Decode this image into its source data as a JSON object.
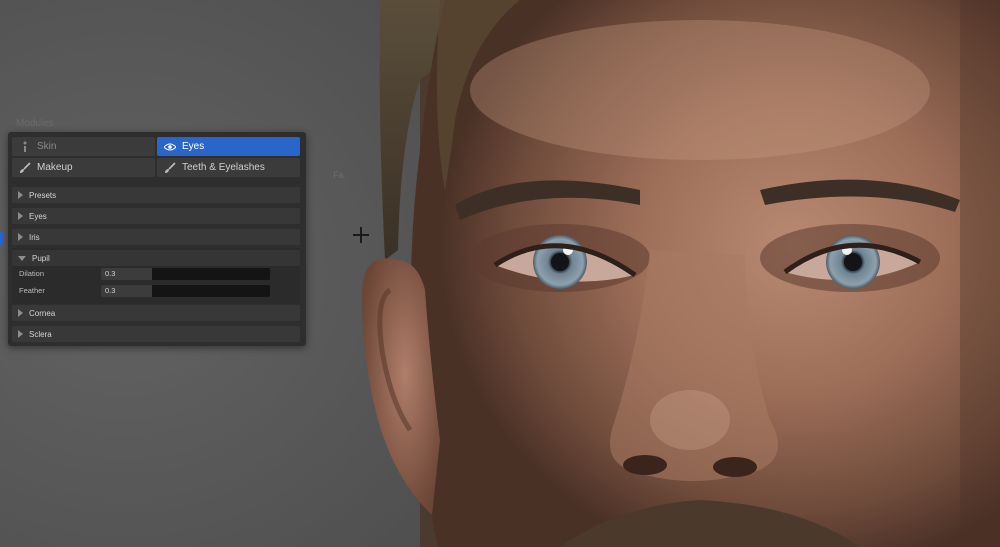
{
  "panel": {
    "heading": "Modules",
    "tabs": [
      {
        "label": "Skin",
        "icon": "skin-icon",
        "active": false
      },
      {
        "label": "Eyes",
        "icon": "eye-icon",
        "active": true
      },
      {
        "label": "Makeup",
        "icon": "brush-icon",
        "active": false
      },
      {
        "label": "Teeth & Eyelashes",
        "icon": "brush-icon",
        "active": false
      }
    ],
    "sections": [
      {
        "label": "Presets",
        "expanded": false
      },
      {
        "label": "Eyes",
        "expanded": false
      },
      {
        "label": "Iris",
        "expanded": false
      },
      {
        "label": "Pupil",
        "expanded": true
      },
      {
        "label": "Cornea",
        "expanded": false
      },
      {
        "label": "Sclera",
        "expanded": false
      }
    ],
    "pupil_properties": [
      {
        "label": "Dilation",
        "value": "0.3",
        "fraction": 0.3
      },
      {
        "label": "Feather",
        "value": "0.3",
        "fraction": 0.3
      }
    ]
  },
  "viewport": {
    "faint_label": "Fa",
    "accent_color": "#2a66c9"
  }
}
